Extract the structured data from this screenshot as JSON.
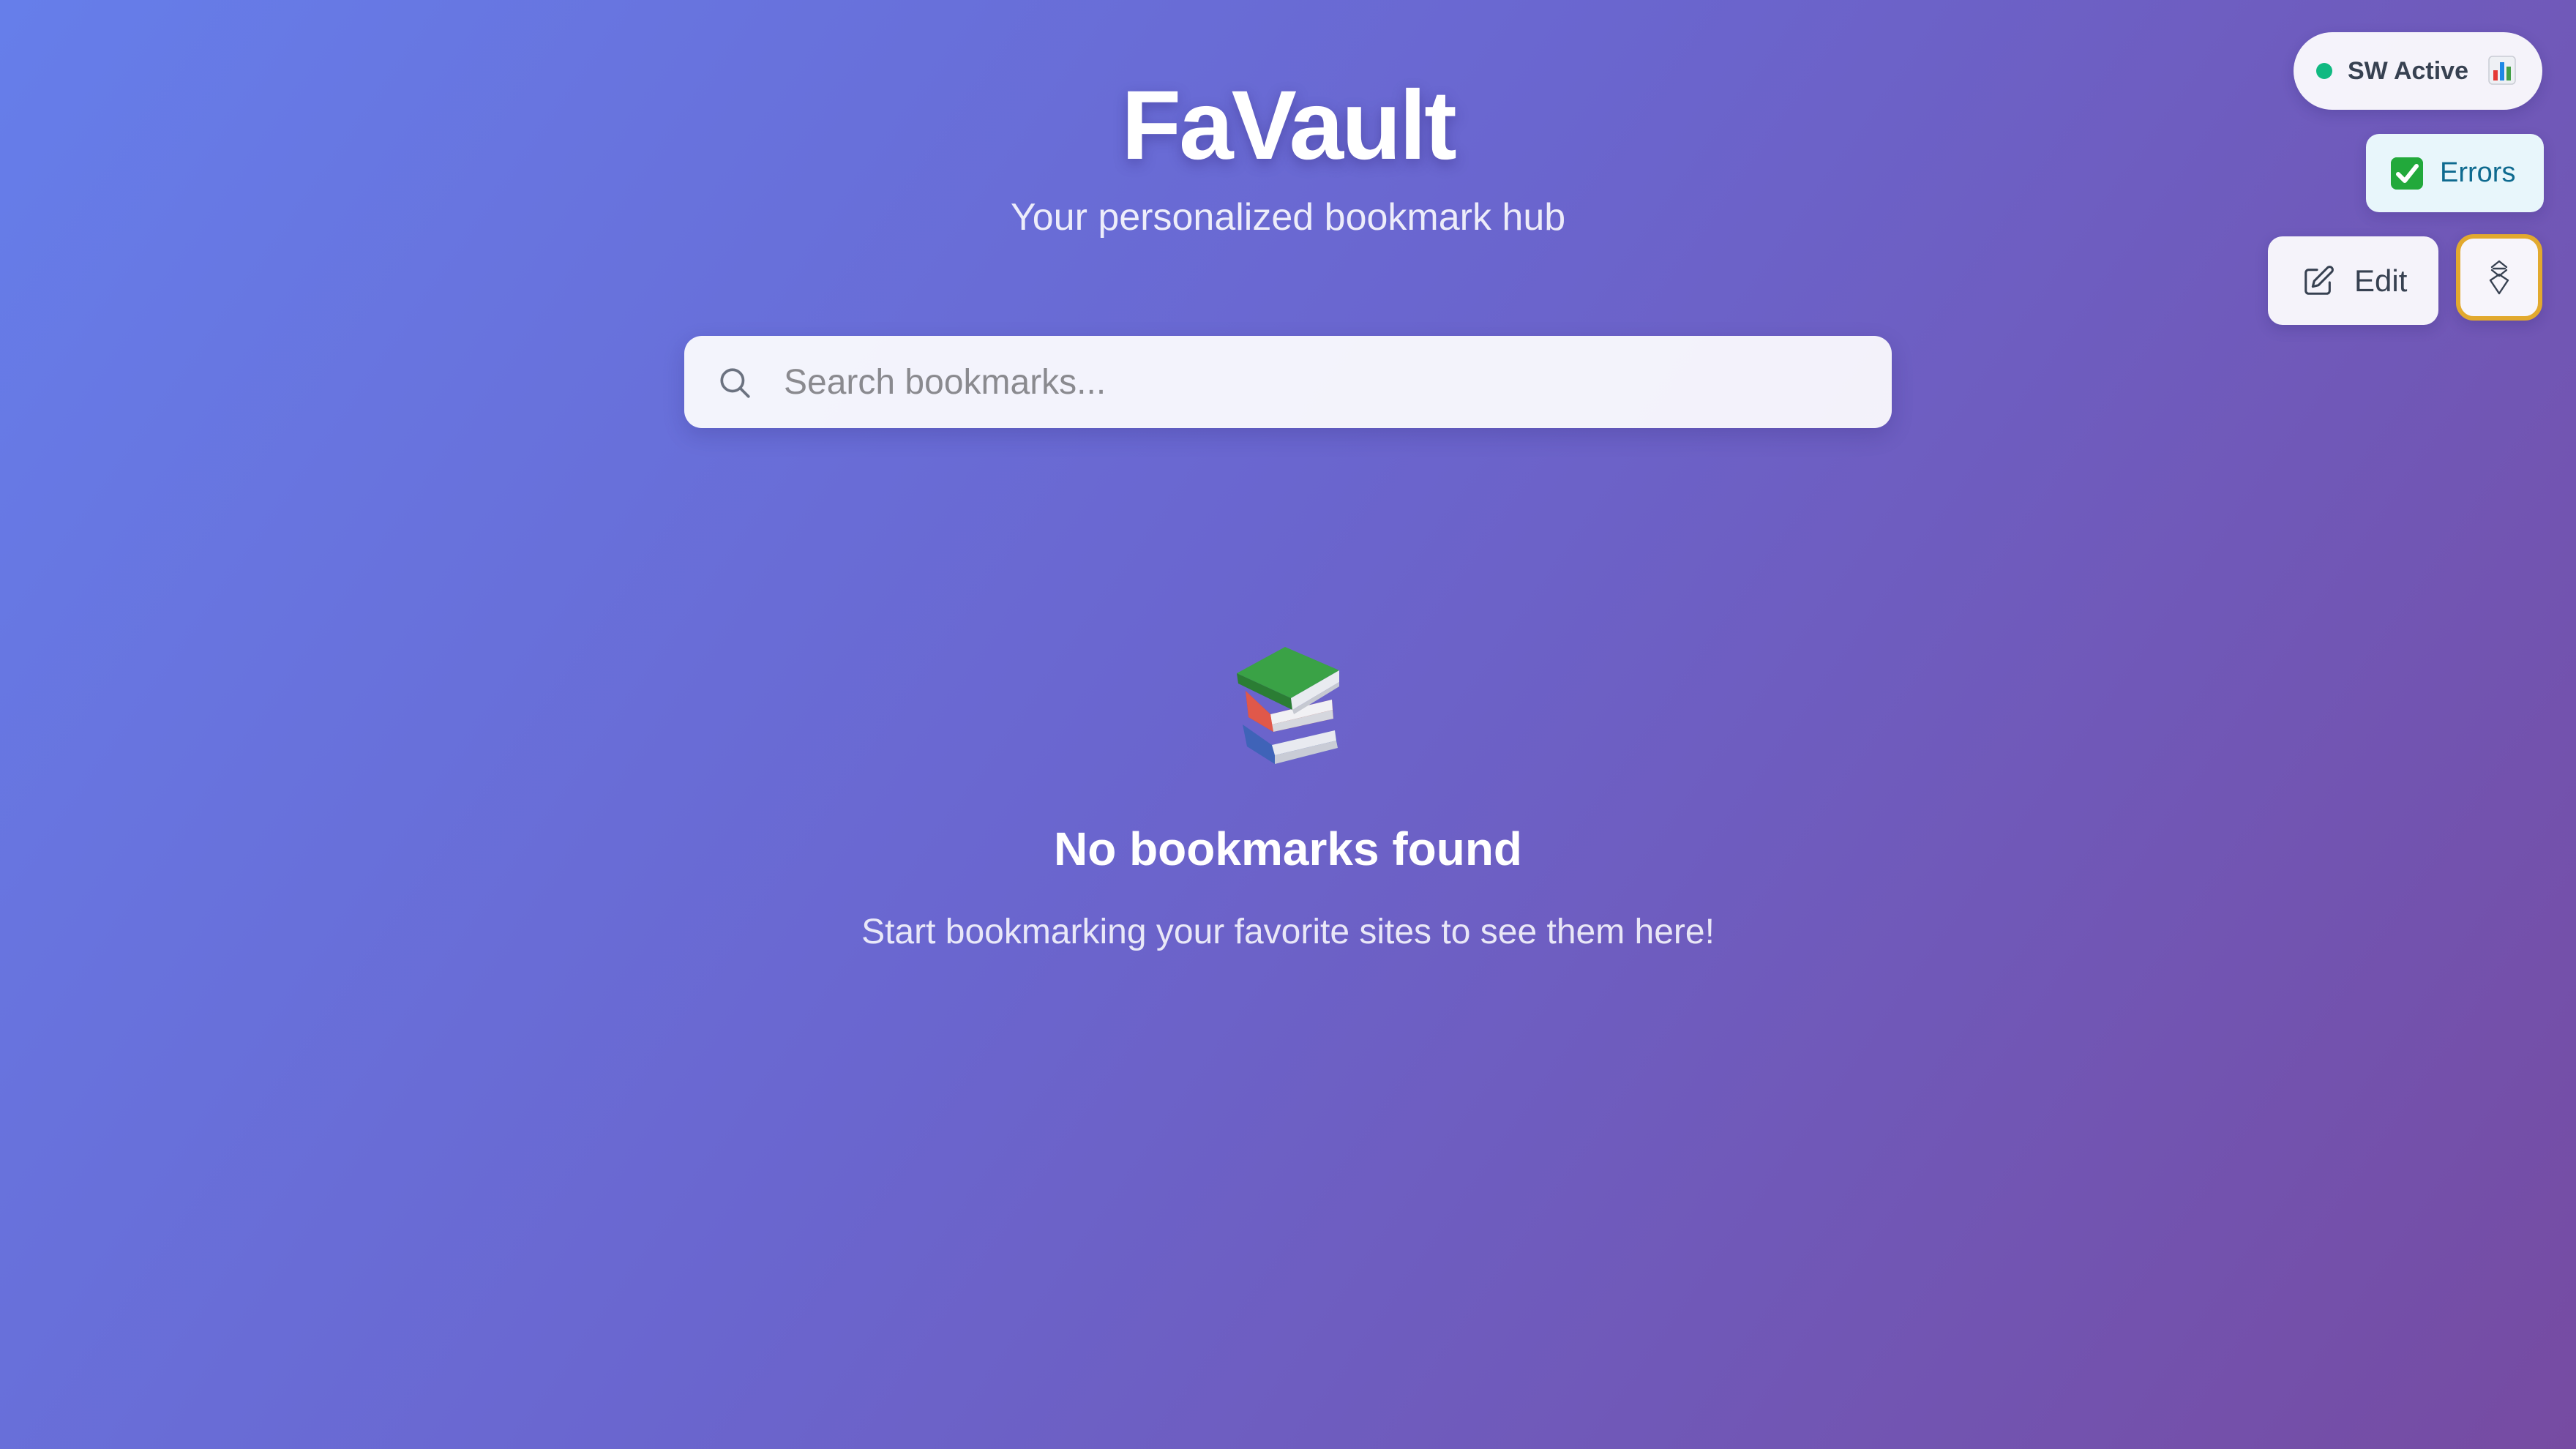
{
  "header": {
    "title": "FaVault",
    "subtitle": "Your personalized bookmark hub"
  },
  "search": {
    "placeholder": "Search bookmarks...",
    "value": "",
    "icon": "search-icon"
  },
  "empty_state": {
    "icon": "books-icon",
    "title": "No bookmarks found",
    "description": "Start bookmarking your favorite sites to see them here!"
  },
  "status": {
    "label": "SW Active",
    "dot_color": "#10b981",
    "icon": "bar-chart-icon"
  },
  "errors_button": {
    "label": "Errors",
    "icon": "check-mark-icon"
  },
  "edit_button": {
    "label": "Edit",
    "icon": "edit-icon"
  },
  "dev_button": {
    "icon": "debug-icon",
    "border_color": "#e2a92e"
  },
  "colors": {
    "background_start": "#667eea",
    "background_end": "#764ba2",
    "text": "#ffffff",
    "errors_text": "#0e6a8f"
  }
}
